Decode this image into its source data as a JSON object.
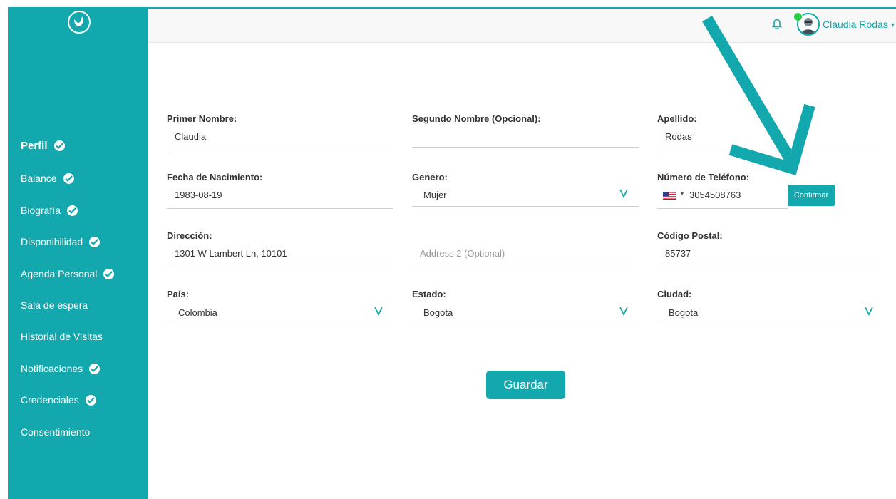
{
  "app": {
    "accent_color": "#12a8ad",
    "logo_icon": "logo-icon"
  },
  "sidebar": {
    "items": [
      {
        "label": "Perfil",
        "checked": true,
        "active": true
      },
      {
        "label": "Balance",
        "checked": true
      },
      {
        "label": "Biografía",
        "checked": true
      },
      {
        "label": "Disponibilidad",
        "checked": true
      },
      {
        "label": "Agenda Personal",
        "checked": true
      },
      {
        "label": "Sala de espera",
        "checked": false
      },
      {
        "label": "Historial de Visitas",
        "checked": false
      },
      {
        "label": "Notificaciones",
        "checked": true
      },
      {
        "label": "Credenciales",
        "checked": true
      },
      {
        "label": "Consentimiento",
        "checked": false
      }
    ]
  },
  "header": {
    "user_name": "Claudia Rodas",
    "bell_icon": "bell-icon",
    "caret": "▾"
  },
  "form": {
    "first_name": {
      "label": "Primer Nombre:",
      "value": "Claudia"
    },
    "middle_name": {
      "label": "Segundo Nombre (Opcional):",
      "value": ""
    },
    "last_name": {
      "label": "Apellido:",
      "value": "Rodas"
    },
    "birth_date": {
      "label": "Fecha de Nacimiento:",
      "value": "1983-08-19"
    },
    "gender": {
      "label": "Genero:",
      "value": "Mujer"
    },
    "phone": {
      "label": "Número de Teléfono:",
      "value": "3054508763",
      "country_flag": "us-flag-icon",
      "confirm_label": "Confirmar"
    },
    "address": {
      "label": "Dirección:",
      "value": "1301 W Lambert Ln, 10101"
    },
    "address2": {
      "placeholder": "Address 2 (Optional)"
    },
    "postal_code": {
      "label": "Código Postal:",
      "value": "85737"
    },
    "country": {
      "label": "País:",
      "value": "Colombia"
    },
    "state": {
      "label": "Estado:",
      "value": "Bogota"
    },
    "city": {
      "label": "Ciudad:",
      "value": "Bogota"
    },
    "save_label": "Guardar"
  }
}
